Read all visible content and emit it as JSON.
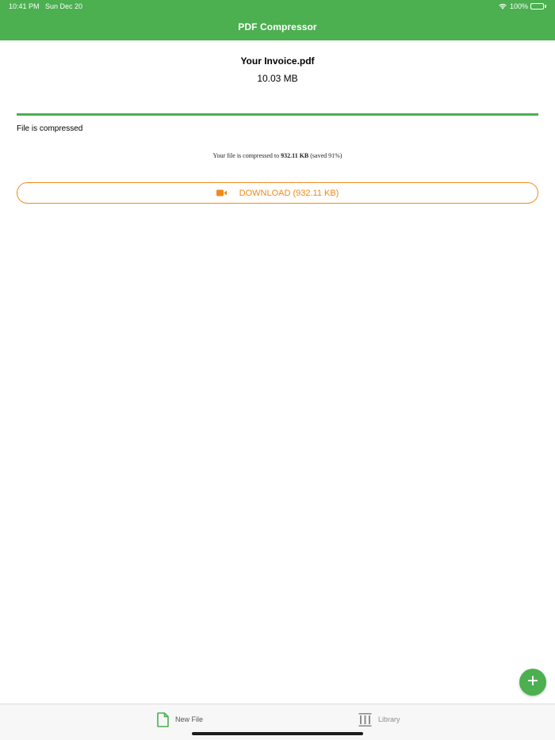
{
  "status_bar": {
    "time_date": "10:41 PM   Sun Dec 20",
    "battery": "100%"
  },
  "nav": {
    "title": "PDF Compressor"
  },
  "file": {
    "name": "Your Invoice.pdf",
    "size": "10.03 MB"
  },
  "progress": {
    "value": 1.0,
    "status": "File is compressed"
  },
  "result": {
    "prefix": "Your file is compressed to ",
    "compressed_size": "932.11 KB",
    "suffix": " (saved 91%)"
  },
  "download_button": {
    "label": "DOWNLOAD (932.11 KB)",
    "icon": "video-camera-icon"
  },
  "fab": {
    "icon": "plus-icon"
  },
  "tabbar": {
    "tabs": [
      {
        "label": "New File",
        "icon": "document-icon",
        "active": true
      },
      {
        "label": "Library",
        "icon": "library-icon",
        "active": false
      }
    ]
  },
  "colors": {
    "primary_green": "#4caf50",
    "accent_orange": "#ef8a1a",
    "tab_inactive": "#8e8e93"
  }
}
